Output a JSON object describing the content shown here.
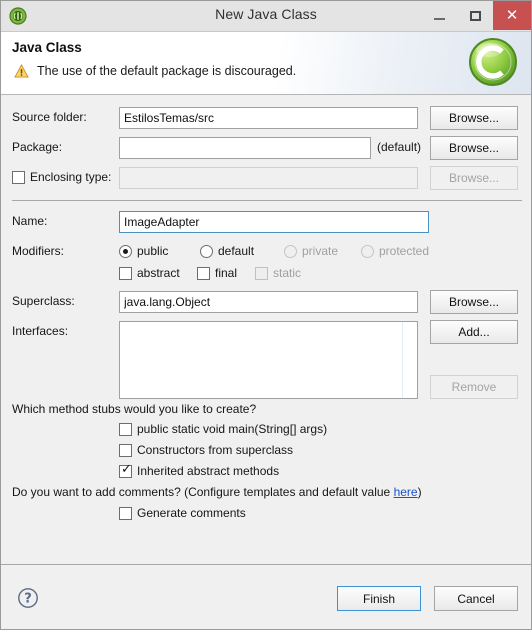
{
  "window": {
    "title": "New Java Class",
    "app_icon": "eclipse-java-icon",
    "minimize_label": "Minimize",
    "maximize_label": "Maximize",
    "close_label": "Close",
    "close_button_color": "#c75050"
  },
  "banner": {
    "title": "Java Class",
    "message": "The use of the default package is discouraged.",
    "status_icon": "warning-icon",
    "logo_icon": "java-class-logo-icon",
    "warning_color": "#f0a830",
    "logo_color": "#7cc142"
  },
  "form": {
    "source_folder": {
      "label": "Source folder:",
      "value": "EstilosTemas/src",
      "browse_label": "Browse...",
      "enabled": true
    },
    "package": {
      "label": "Package:",
      "value": "",
      "suffix": "(default)",
      "browse_label": "Browse...",
      "enabled": true
    },
    "enclosing_type": {
      "label": "Enclosing type:",
      "checked": false,
      "value": "",
      "browse_label": "Browse...",
      "enabled": false
    },
    "name": {
      "label": "Name:",
      "value": "ImageAdapter",
      "focused": true
    },
    "modifiers": {
      "label": "Modifiers:",
      "radios": [
        {
          "label": "public",
          "selected": true,
          "enabled": true
        },
        {
          "label": "default",
          "selected": false,
          "enabled": true
        },
        {
          "label": "private",
          "selected": false,
          "enabled": false
        },
        {
          "label": "protected",
          "selected": false,
          "enabled": false
        }
      ],
      "checkboxes": [
        {
          "label": "abstract",
          "checked": false,
          "enabled": true
        },
        {
          "label": "final",
          "checked": false,
          "enabled": true
        },
        {
          "label": "static",
          "checked": false,
          "enabled": false
        }
      ]
    },
    "superclass": {
      "label": "Superclass:",
      "value": "java.lang.Object",
      "browse_label": "Browse..."
    },
    "interfaces": {
      "label": "Interfaces:",
      "items": [],
      "add_label": "Add...",
      "remove_label": "Remove",
      "remove_enabled": false
    }
  },
  "stubs": {
    "question": "Which method stubs would you like to create?",
    "options": [
      {
        "label": "public static void main(String[] args)",
        "checked": false
      },
      {
        "label": "Constructors from superclass",
        "checked": false
      },
      {
        "label": "Inherited abstract methods",
        "checked": true
      }
    ]
  },
  "comments": {
    "question_prefix": "Do you want to add comments? (Configure templates and default value ",
    "link_label": "here",
    "question_suffix": ")",
    "option": {
      "label": "Generate comments",
      "checked": false
    },
    "link_color": "#1a52c9"
  },
  "footer": {
    "help_icon": "help-question-icon",
    "finish_label": "Finish",
    "cancel_label": "Cancel",
    "default_button_border": "#3c92d4"
  }
}
